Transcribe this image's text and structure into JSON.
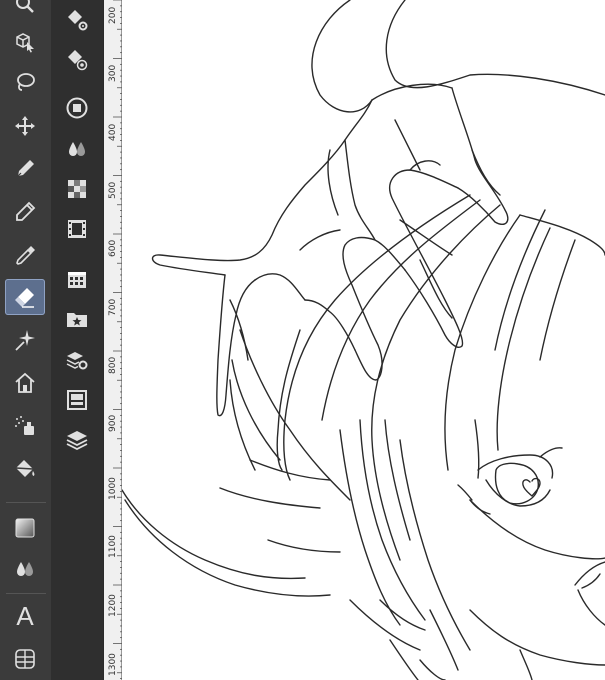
{
  "toolbar": {
    "tools": [
      {
        "name": "zoom-tool",
        "icon": "magnifier-icon",
        "active": false
      },
      {
        "name": "operation-tool",
        "icon": "cube-arrow-icon",
        "active": false
      },
      {
        "name": "lasso-tool",
        "icon": "lasso-icon",
        "active": false
      },
      {
        "name": "move-tool",
        "icon": "move-arrows-icon",
        "active": false
      },
      {
        "name": "pen-tool",
        "icon": "pen-nib-icon",
        "active": false
      },
      {
        "name": "pencil-tool",
        "icon": "pencil-icon",
        "active": false
      },
      {
        "name": "eyedropper-tool",
        "icon": "eyedropper-icon",
        "active": false
      },
      {
        "name": "eraser-tool",
        "icon": "eraser-icon",
        "active": true
      },
      {
        "name": "decoration-tool",
        "icon": "sparkle-icon",
        "active": false
      },
      {
        "name": "house-tool",
        "icon": "house-icon",
        "active": false
      },
      {
        "name": "airbrush-tool",
        "icon": "airbrush-icon",
        "active": false
      },
      {
        "name": "fill-tool",
        "icon": "bucket-icon",
        "active": false
      },
      {
        "name": "gradient-tool",
        "icon": "gradient-square-icon",
        "active": false
      },
      {
        "name": "blend-tool",
        "icon": "drops-icon",
        "active": false
      },
      {
        "name": "text-tool",
        "icon": "text-a-icon",
        "active": false,
        "label": "A"
      },
      {
        "name": "frame-tool",
        "icon": "grid-frame-icon",
        "active": false
      }
    ]
  },
  "palette": {
    "items": [
      {
        "name": "tool-settings",
        "icon": "eraser-gear-icon"
      },
      {
        "name": "brush-size",
        "icon": "eraser-dot-icon"
      },
      {
        "name": "color-circle",
        "icon": "circle-square-icon"
      },
      {
        "name": "color-mix",
        "icon": "drops-icon"
      },
      {
        "name": "color-set",
        "icon": "color-grid-icon"
      },
      {
        "name": "animation-timeline",
        "icon": "film-icon"
      },
      {
        "name": "page-manager",
        "icon": "calendar-grid-icon"
      },
      {
        "name": "material",
        "icon": "folder-star-icon"
      },
      {
        "name": "sub-tool-detail",
        "icon": "layers-gear-icon"
      },
      {
        "name": "layer-property",
        "icon": "panel-icon"
      },
      {
        "name": "layers",
        "icon": "layers-icon"
      }
    ]
  },
  "ruler": {
    "labels": [
      "200",
      "300",
      "400",
      "500",
      "600",
      "700",
      "800",
      "900",
      "1000",
      "1100",
      "1200",
      "1300"
    ]
  },
  "colors": {
    "toolbar_bg": "#3b3b3b",
    "palette_bg": "#2f2f2f",
    "active_tool": "#5d6f8e",
    "icon": "#e0e0e0",
    "ruler_bg": "#f0f0f0",
    "canvas_bg": "#ffffff",
    "line_art": "#2a2a2a"
  }
}
